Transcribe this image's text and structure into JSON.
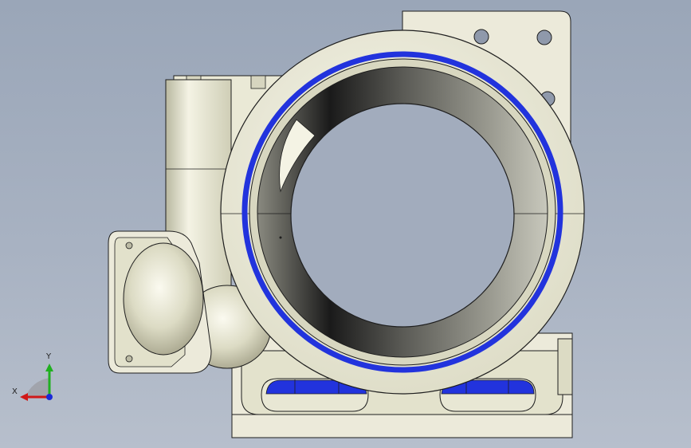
{
  "viewport": {
    "background_top": "#9aa6b8",
    "background_bottom": "#b7bfcc"
  },
  "model": {
    "body_color": "#ecebd8",
    "shade_color": "#c9c8b0",
    "seal_ring_color": "#2233dd",
    "edge_color": "#1e1e1e"
  },
  "triad": {
    "x_label": "X",
    "y_label": "Y",
    "x_axis_color": "#d01818",
    "y_axis_color": "#20b020",
    "z_axis_color": "#1a2ad8"
  }
}
